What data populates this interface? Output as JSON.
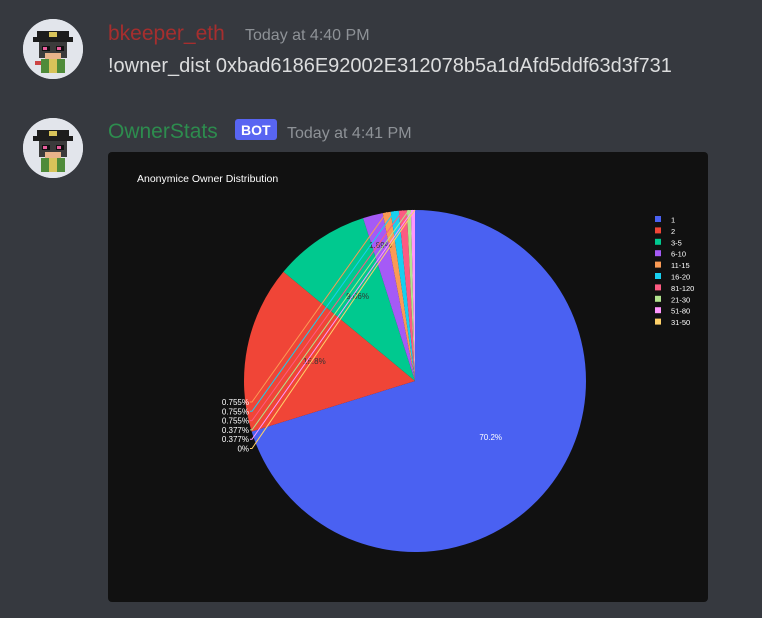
{
  "messages": [
    {
      "author": "bkeeper_eth",
      "author_color": "#a62e2e",
      "timestamp": "Today at 4:40 PM",
      "content": "!owner_dist 0xbad6186E92002E312078b5a1dAfd5ddf63d3f731",
      "avatar_icon": "pixel-mouse-captain-avatar"
    },
    {
      "author": "OwnerStats",
      "author_color": "#2d8c4e",
      "bot_tag": "BOT",
      "timestamp": "Today at 4:41 PM",
      "avatar_icon": "pixel-mouse-captain-avatar"
    }
  ],
  "chart_data": {
    "type": "pie",
    "title": "Anonymice Owner Distribution",
    "legend_position": "top-right",
    "slices": [
      {
        "label": "1",
        "value": 70.2,
        "text": "70.2%",
        "color": "#4a61f2"
      },
      {
        "label": "2",
        "value": 15.8,
        "text": "15.8%",
        "color": "#f04537"
      },
      {
        "label": "3-5",
        "value": 9.06,
        "text": "9.06%",
        "color": "#00c98f"
      },
      {
        "label": "6-10",
        "value": 1.89,
        "text": "1.89%",
        "color": "#a55af6"
      },
      {
        "label": "11-15",
        "value": 0.755,
        "text": "0.755%",
        "color": "#fa9a55"
      },
      {
        "label": "16-20",
        "value": 0.755,
        "text": "0.755%",
        "color": "#18d0f0"
      },
      {
        "label": "81-120",
        "value": 0.755,
        "text": "0.755%",
        "color": "#fd5b82"
      },
      {
        "label": "21-30",
        "value": 0.377,
        "text": "0.377%",
        "color": "#b2e48e"
      },
      {
        "label": "51-80",
        "value": 0.377,
        "text": "0.377%",
        "color": "#fe96fe"
      },
      {
        "label": "31-50",
        "value": 0,
        "text": "0%",
        "color": "#fed16a"
      }
    ]
  }
}
